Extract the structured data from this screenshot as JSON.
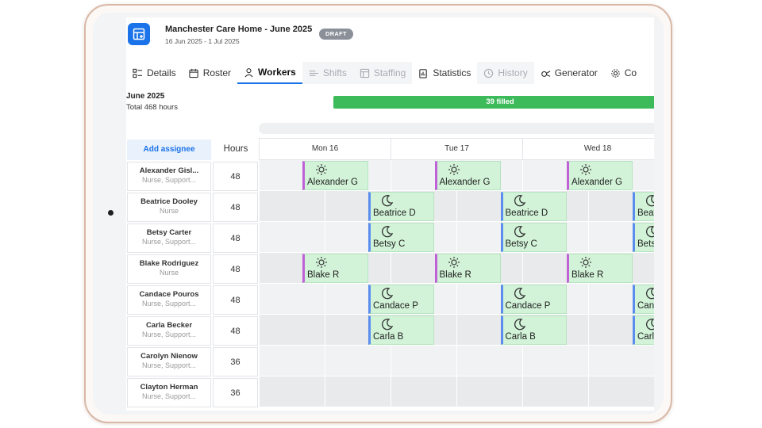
{
  "header": {
    "title": "Manchester Care Home - June 2025",
    "date_range": "16 Jun 2025 - 1 Jul 2025",
    "badge": "DRAFT",
    "app_icon": "roster-grid-icon"
  },
  "tabs": [
    {
      "label": "Details",
      "icon": "details-icon",
      "state": "normal"
    },
    {
      "label": "Roster",
      "icon": "calendar-icon",
      "state": "normal"
    },
    {
      "label": "Workers",
      "icon": "person-icon",
      "state": "active"
    },
    {
      "label": "Shifts",
      "icon": "shifts-icon",
      "state": "disabled"
    },
    {
      "label": "Staffing",
      "icon": "staffing-icon",
      "state": "disabled"
    },
    {
      "label": "Statistics",
      "icon": "statistics-icon",
      "state": "normal"
    },
    {
      "label": "History",
      "icon": "history-icon",
      "state": "disabled"
    },
    {
      "label": "Generator",
      "icon": "generator-icon",
      "state": "normal"
    },
    {
      "label": "Co",
      "icon": "gear-icon",
      "state": "normal"
    }
  ],
  "summary": {
    "month": "June 2025",
    "total_hours": "Total 468 hours",
    "filled_label": "39 filled",
    "fill_color": "#3dbb5b"
  },
  "grid": {
    "add_assignee": "Add assignee",
    "hours_header": "Hours",
    "days": [
      "Mon 16",
      "Tue 17",
      "Wed 18"
    ]
  },
  "workers": [
    {
      "name": "Alexander Gisl...",
      "role": "Nurse, Support...",
      "hours": "48",
      "shift": "day",
      "label": "Alexander G"
    },
    {
      "name": "Beatrice Dooley",
      "role": "Nurse",
      "hours": "48",
      "shift": "night",
      "label": "Beatrice D"
    },
    {
      "name": "Betsy Carter",
      "role": "Nurse, Support...",
      "hours": "48",
      "shift": "night",
      "label": "Betsy C"
    },
    {
      "name": "Blake Rodriguez",
      "role": "Nurse",
      "hours": "48",
      "shift": "day",
      "label": "Blake R"
    },
    {
      "name": "Candace Pouros",
      "role": "Nurse, Support...",
      "hours": "48",
      "shift": "night",
      "label": "Candace P"
    },
    {
      "name": "Carla Becker",
      "role": "Nurse, Support...",
      "hours": "48",
      "shift": "night",
      "label": "Carla B"
    },
    {
      "name": "Carolyn Nienow",
      "role": "Nurse, Support...",
      "hours": "36",
      "shift": null,
      "label": ""
    },
    {
      "name": "Clayton Herman",
      "role": "Nurse, Support...",
      "hours": "36",
      "shift": null,
      "label": ""
    }
  ],
  "colors": {
    "accent": "#1a73e8",
    "shift_fill": "#d2f3d8",
    "day_stripe": "#c061d8",
    "night_stripe": "#5b8def"
  }
}
